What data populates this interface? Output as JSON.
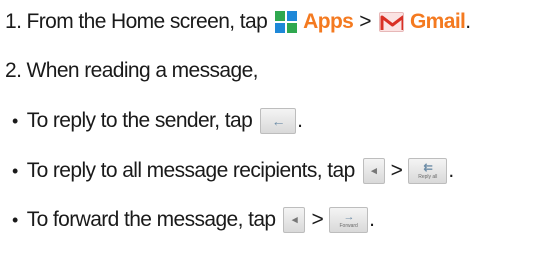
{
  "steps": {
    "step1": {
      "text": "1. From the Home screen, tap",
      "apps_label": "Apps",
      "separator": ">",
      "gmail_label": "Gmail",
      "end": "."
    },
    "step2": {
      "text": "2. When reading a message,"
    },
    "bullets": [
      {
        "text": "To reply to the sender, tap",
        "end": "."
      },
      {
        "text": "To reply to all message recipients, tap",
        "separator": ">",
        "button_label": "Reply all",
        "end": "."
      },
      {
        "text": "To forward the message, tap",
        "separator": ">",
        "button_label": "Forward",
        "end": "."
      }
    ],
    "bullet_char": "•"
  },
  "colors": {
    "accent": "#f47a20",
    "text": "#1a1a1a",
    "apps_green": "#2fa84f",
    "apps_blue": "#1e88d8",
    "gmail_red": "#d93025"
  },
  "icons": {
    "apps": "apps-grid-icon",
    "gmail": "gmail-icon",
    "reply": "reply-arrow-icon",
    "menu": "menu-arrow-icon",
    "reply_all": "reply-all-icon",
    "forward": "forward-icon"
  }
}
